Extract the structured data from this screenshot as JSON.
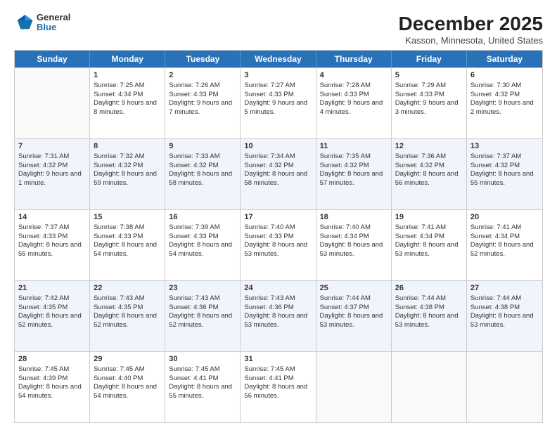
{
  "logo": {
    "general": "General",
    "blue": "Blue"
  },
  "title": "December 2025",
  "subtitle": "Kasson, Minnesota, United States",
  "header_days": [
    "Sunday",
    "Monday",
    "Tuesday",
    "Wednesday",
    "Thursday",
    "Friday",
    "Saturday"
  ],
  "weeks": [
    [
      {
        "day": "",
        "sunrise": "",
        "sunset": "",
        "daylight": ""
      },
      {
        "day": "1",
        "sunrise": "Sunrise: 7:25 AM",
        "sunset": "Sunset: 4:34 PM",
        "daylight": "Daylight: 9 hours and 8 minutes."
      },
      {
        "day": "2",
        "sunrise": "Sunrise: 7:26 AM",
        "sunset": "Sunset: 4:33 PM",
        "daylight": "Daylight: 9 hours and 7 minutes."
      },
      {
        "day": "3",
        "sunrise": "Sunrise: 7:27 AM",
        "sunset": "Sunset: 4:33 PM",
        "daylight": "Daylight: 9 hours and 5 minutes."
      },
      {
        "day": "4",
        "sunrise": "Sunrise: 7:28 AM",
        "sunset": "Sunset: 4:33 PM",
        "daylight": "Daylight: 9 hours and 4 minutes."
      },
      {
        "day": "5",
        "sunrise": "Sunrise: 7:29 AM",
        "sunset": "Sunset: 4:33 PM",
        "daylight": "Daylight: 9 hours and 3 minutes."
      },
      {
        "day": "6",
        "sunrise": "Sunrise: 7:30 AM",
        "sunset": "Sunset: 4:32 PM",
        "daylight": "Daylight: 9 hours and 2 minutes."
      }
    ],
    [
      {
        "day": "7",
        "sunrise": "Sunrise: 7:31 AM",
        "sunset": "Sunset: 4:32 PM",
        "daylight": "Daylight: 9 hours and 1 minute."
      },
      {
        "day": "8",
        "sunrise": "Sunrise: 7:32 AM",
        "sunset": "Sunset: 4:32 PM",
        "daylight": "Daylight: 8 hours and 59 minutes."
      },
      {
        "day": "9",
        "sunrise": "Sunrise: 7:33 AM",
        "sunset": "Sunset: 4:32 PM",
        "daylight": "Daylight: 8 hours and 58 minutes."
      },
      {
        "day": "10",
        "sunrise": "Sunrise: 7:34 AM",
        "sunset": "Sunset: 4:32 PM",
        "daylight": "Daylight: 8 hours and 58 minutes."
      },
      {
        "day": "11",
        "sunrise": "Sunrise: 7:35 AM",
        "sunset": "Sunset: 4:32 PM",
        "daylight": "Daylight: 8 hours and 57 minutes."
      },
      {
        "day": "12",
        "sunrise": "Sunrise: 7:36 AM",
        "sunset": "Sunset: 4:32 PM",
        "daylight": "Daylight: 8 hours and 56 minutes."
      },
      {
        "day": "13",
        "sunrise": "Sunrise: 7:37 AM",
        "sunset": "Sunset: 4:32 PM",
        "daylight": "Daylight: 8 hours and 55 minutes."
      }
    ],
    [
      {
        "day": "14",
        "sunrise": "Sunrise: 7:37 AM",
        "sunset": "Sunset: 4:33 PM",
        "daylight": "Daylight: 8 hours and 55 minutes."
      },
      {
        "day": "15",
        "sunrise": "Sunrise: 7:38 AM",
        "sunset": "Sunset: 4:33 PM",
        "daylight": "Daylight: 8 hours and 54 minutes."
      },
      {
        "day": "16",
        "sunrise": "Sunrise: 7:39 AM",
        "sunset": "Sunset: 4:33 PM",
        "daylight": "Daylight: 8 hours and 54 minutes."
      },
      {
        "day": "17",
        "sunrise": "Sunrise: 7:40 AM",
        "sunset": "Sunset: 4:33 PM",
        "daylight": "Daylight: 8 hours and 53 minutes."
      },
      {
        "day": "18",
        "sunrise": "Sunrise: 7:40 AM",
        "sunset": "Sunset: 4:34 PM",
        "daylight": "Daylight: 8 hours and 53 minutes."
      },
      {
        "day": "19",
        "sunrise": "Sunrise: 7:41 AM",
        "sunset": "Sunset: 4:34 PM",
        "daylight": "Daylight: 8 hours and 53 minutes."
      },
      {
        "day": "20",
        "sunrise": "Sunrise: 7:41 AM",
        "sunset": "Sunset: 4:34 PM",
        "daylight": "Daylight: 8 hours and 52 minutes."
      }
    ],
    [
      {
        "day": "21",
        "sunrise": "Sunrise: 7:42 AM",
        "sunset": "Sunset: 4:35 PM",
        "daylight": "Daylight: 8 hours and 52 minutes."
      },
      {
        "day": "22",
        "sunrise": "Sunrise: 7:43 AM",
        "sunset": "Sunset: 4:35 PM",
        "daylight": "Daylight: 8 hours and 52 minutes."
      },
      {
        "day": "23",
        "sunrise": "Sunrise: 7:43 AM",
        "sunset": "Sunset: 4:36 PM",
        "daylight": "Daylight: 8 hours and 52 minutes."
      },
      {
        "day": "24",
        "sunrise": "Sunrise: 7:43 AM",
        "sunset": "Sunset: 4:36 PM",
        "daylight": "Daylight: 8 hours and 53 minutes."
      },
      {
        "day": "25",
        "sunrise": "Sunrise: 7:44 AM",
        "sunset": "Sunset: 4:37 PM",
        "daylight": "Daylight: 8 hours and 53 minutes."
      },
      {
        "day": "26",
        "sunrise": "Sunrise: 7:44 AM",
        "sunset": "Sunset: 4:38 PM",
        "daylight": "Daylight: 8 hours and 53 minutes."
      },
      {
        "day": "27",
        "sunrise": "Sunrise: 7:44 AM",
        "sunset": "Sunset: 4:38 PM",
        "daylight": "Daylight: 8 hours and 53 minutes."
      }
    ],
    [
      {
        "day": "28",
        "sunrise": "Sunrise: 7:45 AM",
        "sunset": "Sunset: 4:39 PM",
        "daylight": "Daylight: 8 hours and 54 minutes."
      },
      {
        "day": "29",
        "sunrise": "Sunrise: 7:45 AM",
        "sunset": "Sunset: 4:40 PM",
        "daylight": "Daylight: 8 hours and 54 minutes."
      },
      {
        "day": "30",
        "sunrise": "Sunrise: 7:45 AM",
        "sunset": "Sunset: 4:41 PM",
        "daylight": "Daylight: 8 hours and 55 minutes."
      },
      {
        "day": "31",
        "sunrise": "Sunrise: 7:45 AM",
        "sunset": "Sunset: 4:41 PM",
        "daylight": "Daylight: 8 hours and 56 minutes."
      },
      {
        "day": "",
        "sunrise": "",
        "sunset": "",
        "daylight": ""
      },
      {
        "day": "",
        "sunrise": "",
        "sunset": "",
        "daylight": ""
      },
      {
        "day": "",
        "sunrise": "",
        "sunset": "",
        "daylight": ""
      }
    ]
  ]
}
